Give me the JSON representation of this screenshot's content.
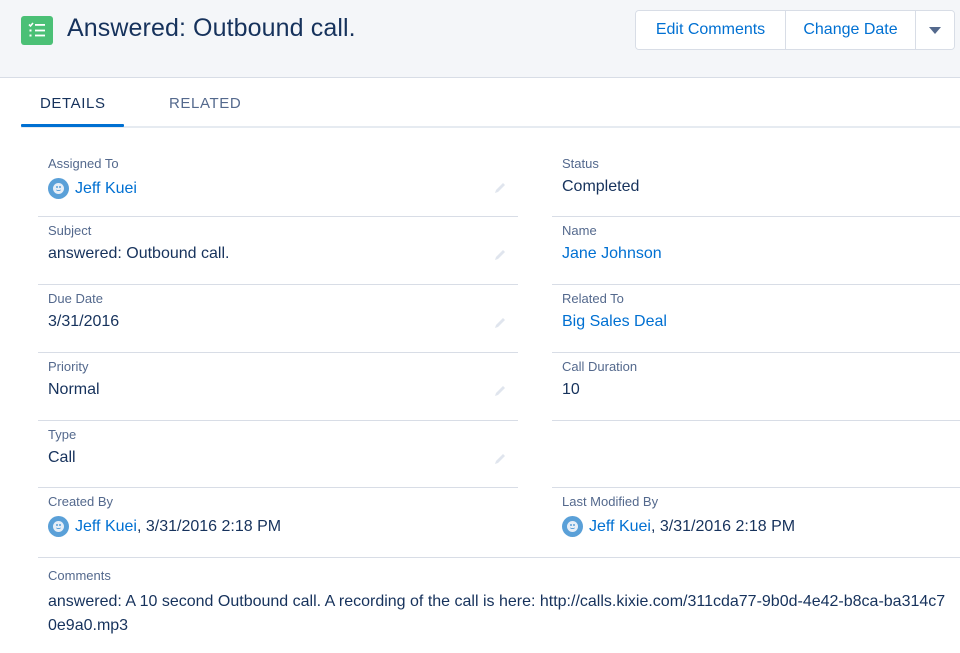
{
  "header": {
    "title": "Answered: Outbound call.",
    "record_icon": "task-checklist-icon",
    "actions": {
      "edit_comments": "Edit Comments",
      "change_date": "Change Date",
      "more_icon": "chevron-down-icon"
    }
  },
  "tabs": [
    {
      "label": "DETAILS",
      "active": true
    },
    {
      "label": "RELATED",
      "active": false
    }
  ],
  "fields": {
    "assigned_to": {
      "label": "Assigned To",
      "value": "Jeff Kuei"
    },
    "status": {
      "label": "Status",
      "value": "Completed"
    },
    "subject": {
      "label": "Subject",
      "value": "answered: Outbound call."
    },
    "name": {
      "label": "Name",
      "value": "Jane Johnson"
    },
    "due_date": {
      "label": "Due Date",
      "value": "3/31/2016"
    },
    "related_to": {
      "label": "Related To",
      "value": "Big Sales Deal"
    },
    "priority": {
      "label": "Priority",
      "value": "Normal"
    },
    "call_duration": {
      "label": "Call Duration",
      "value": "10"
    },
    "type": {
      "label": "Type",
      "value": "Call"
    },
    "created_by": {
      "label": "Created By",
      "user": "Jeff Kuei",
      "timestamp": ", 3/31/2016 2:18 PM"
    },
    "last_modified_by": {
      "label": "Last Modified By",
      "user": "Jeff Kuei",
      "timestamp": ", 3/31/2016 2:18 PM"
    },
    "comments": {
      "label": "Comments",
      "value": "answered: A 10 second Outbound call. A recording of the call is here: http://calls.kixie.com/311cda77-9b0d-4e42-b8ca-ba314c70e9a0.mp3"
    }
  },
  "colors": {
    "brand_blue": "#0070d2",
    "text_dark": "#16325c",
    "label_gray": "#54698d",
    "task_green": "#4bc076"
  }
}
